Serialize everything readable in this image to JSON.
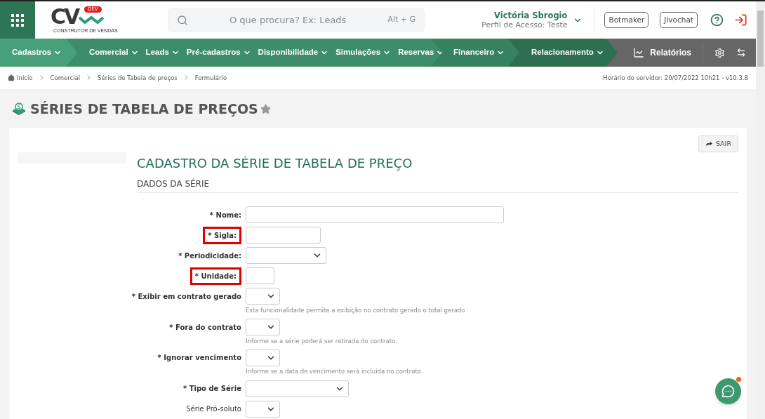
{
  "topbar": {
    "logo": {
      "letters": "CV",
      "badge": "DEV",
      "tagline": "CONSTRUTOR DE VENDAS"
    },
    "search": {
      "placeholder": "O que procura? Ex: Leads",
      "shortcut": "Alt + G"
    },
    "user": {
      "name": "Victória Sbrogio",
      "profile": "Perfil de Acesso: Teste"
    },
    "buttons": [
      "Botmaker",
      "Jivochat"
    ]
  },
  "nav": {
    "groups": [
      {
        "color": "#48a07b",
        "items": [
          "Cadastros"
        ]
      },
      {
        "color": "#3d8d6a",
        "items": [
          "Comercial",
          "Leads",
          "Pré-cadastros",
          "Disponibilidade",
          "Simulações",
          "Reservas"
        ]
      },
      {
        "color": "#368160",
        "items": [
          "Financeiro"
        ]
      },
      {
        "color": "#2e6f52",
        "items": [
          "Relacionamento"
        ]
      }
    ],
    "reports": "Relatórios"
  },
  "breadcrumb": [
    "Início",
    "Comercial",
    "Séries de Tabela de preços",
    "Formulário"
  ],
  "server_info": "Horário do servidor: 20/07/2022 10h21 - v10.3.8",
  "page_title": "SÉRIES DE TABELA DE PREÇOS",
  "favorite": false,
  "exit_button": "SAIR",
  "form": {
    "title": "CADASTRO DA SÉRIE DE TABELA DE PREÇO",
    "section": "DADOS DA SÉRIE",
    "fields": [
      {
        "label": "* Nome:",
        "kind": "text",
        "required": true,
        "highlighted": false
      },
      {
        "label": "* Sigla:",
        "kind": "text",
        "required": true,
        "highlighted": true
      },
      {
        "label": "* Periodicidade:",
        "kind": "select",
        "required": true,
        "highlighted": false
      },
      {
        "label": "* Unidade:",
        "kind": "text",
        "required": true,
        "highlighted": true
      },
      {
        "label": "* Exibir em contrato gerado",
        "kind": "select",
        "required": true,
        "highlighted": false,
        "hint": "Esta funcionalidade permite a exibição no contrato gerado o total gerado"
      },
      {
        "label": "* Fora do contrato",
        "kind": "select",
        "required": true,
        "highlighted": false,
        "hint": "Informe se a série poderá ser retirada do contrato."
      },
      {
        "label": "* Ignorar vencimento",
        "kind": "select",
        "required": true,
        "highlighted": false,
        "hint": "Informe se a data de vencimento será incluída no contrato."
      },
      {
        "label": "* Tipo de Série",
        "kind": "select",
        "required": true,
        "highlighted": false
      },
      {
        "label": "Série Pró-soluto",
        "kind": "select",
        "required": false,
        "highlighted": false
      }
    ]
  },
  "chat": {
    "unread": true
  }
}
